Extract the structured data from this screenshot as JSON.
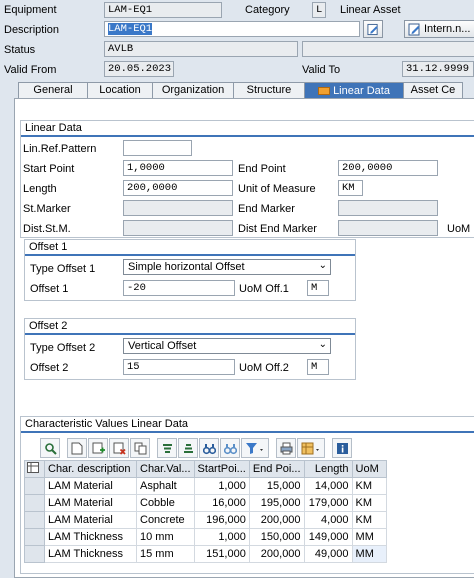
{
  "header": {
    "equipment_label": "Equipment",
    "equipment_value": "LAM-EQ1",
    "category_label": "Category",
    "category_value": "L",
    "category_text": "Linear Asset",
    "description_label": "Description",
    "description_value": "LAM-EQ1",
    "intern_button": "Intern.n...",
    "status_label": "Status",
    "status_value": "AVLB",
    "valid_from_label": "Valid From",
    "valid_from_value": "20.05.2023",
    "valid_to_label": "Valid To",
    "valid_to_value": "31.12.9999"
  },
  "tabs": [
    {
      "label": "General"
    },
    {
      "label": "Location"
    },
    {
      "label": "Organization"
    },
    {
      "label": "Structure"
    },
    {
      "label": "Linear Data"
    },
    {
      "label": "Asset Ce"
    }
  ],
  "linear_data": {
    "title": "Linear Data",
    "lin_ref_pattern_label": "Lin.Ref.Pattern",
    "lin_ref_pattern_value": "",
    "start_point_label": "Start Point",
    "start_point_value": "1,0000",
    "end_point_label": "End Point",
    "end_point_value": "200,0000",
    "length_label": "Length",
    "length_value": "200,0000",
    "uom_label": "Unit of Measure",
    "uom_value": "KM",
    "st_marker_label": "St.Marker",
    "end_marker_label": "End Marker",
    "dist_st_m_label": "Dist.St.M.",
    "dist_end_marker_label": "Dist End Marker",
    "uom_short_label": "UoM"
  },
  "offset1": {
    "title": "Offset 1",
    "type_label": "Type Offset 1",
    "type_value": "Simple horizontal Offset",
    "offset_label": "Offset 1",
    "offset_value": "-20",
    "uom_label": "UoM Off.1",
    "uom_value": "M"
  },
  "offset2": {
    "title": "Offset 2",
    "type_label": "Type Offset 2",
    "type_value": "Vertical Offset",
    "offset_label": "Offset 2",
    "offset_value": "15",
    "uom_label": "UoM Off.2",
    "uom_value": "M"
  },
  "char_values": {
    "title": "Characteristic Values Linear Data",
    "columns": [
      "Char. description",
      "Char.Val...",
      "StartPoi...",
      "End Poi...",
      "Length",
      "UoM"
    ],
    "rows": [
      [
        "LAM Material",
        "Asphalt",
        "1,000",
        "15,000",
        "14,000",
        "KM"
      ],
      [
        "LAM Material",
        "Cobble",
        "16,000",
        "195,000",
        "179,000",
        "KM"
      ],
      [
        "LAM Material",
        "Concrete",
        "196,000",
        "200,000",
        "4,000",
        "KM"
      ],
      [
        "LAM Thickness",
        "10 mm",
        "1,000",
        "150,000",
        "149,000",
        "MM"
      ],
      [
        "LAM Thickness",
        "15 mm",
        "151,000",
        "200,000",
        "49,000",
        "MM"
      ]
    ]
  },
  "colors": {
    "accent": "#3f74b8",
    "background": "#dfe6ee"
  }
}
